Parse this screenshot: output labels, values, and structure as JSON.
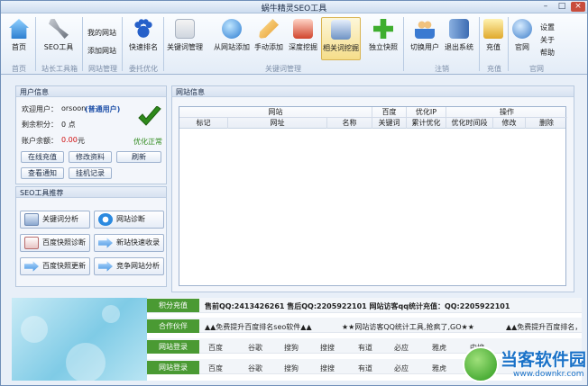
{
  "window": {
    "title": "蜗牛精灵SEO工具",
    "controls": [
      "–",
      "□",
      "×"
    ]
  },
  "ribbon": {
    "home": "首页",
    "seo_tool": "SEO工具",
    "my_sites": "我的网站",
    "add_site": "添加网站",
    "baidu_rank": "快速排名",
    "keyword_mgmt": "关键词管理",
    "from_site_add": "从网站添加",
    "manual_add": "手动添加",
    "deep_mine": "深度挖掘",
    "related_mine": "相关词挖掘",
    "independent_snapshot": "独立快照",
    "switch_user": "切换用户",
    "logout": "退出系统",
    "recharge": "充值",
    "official_site": "官网",
    "settings": "设置",
    "about": "关于",
    "help": "帮助",
    "groups": {
      "home": "首页",
      "toolbox": "站长工具箱",
      "site_mgmt": "网站管理",
      "ad_opt": "委托优化",
      "kw_mgmt": "关键词管理",
      "logout": "注销",
      "recharge": "充值",
      "official": "官网"
    }
  },
  "user": {
    "panel_title": "用户信息",
    "welcome_label": "欢迎用户：",
    "username": "orsoon",
    "user_type": "(普通用户)",
    "points_label": "剩余积分：",
    "points_value": "0 点",
    "balance_label": "账户余额：",
    "balance_value": "0.00",
    "balance_unit": "元",
    "status": "优化正常",
    "buttons": {
      "recharge": "在线充值",
      "edit": "修改资料",
      "refresh": "刷新",
      "notice": "查看通知",
      "log": "挂机记录"
    }
  },
  "seo_tools": {
    "title": "SEO工具推荐",
    "items": [
      {
        "label": "关键词分析",
        "icon": "keyword-analysis-icon"
      },
      {
        "label": "网站诊断",
        "icon": "ie-icon"
      },
      {
        "label": "百度快照诊断",
        "icon": "snapshot-diagnose-icon"
      },
      {
        "label": "新站快速收录",
        "icon": "arrows-icon"
      },
      {
        "label": "百度快照更新",
        "icon": "arrows-icon"
      },
      {
        "label": "竞争网站分析",
        "icon": "arrows-icon"
      }
    ]
  },
  "site_info": {
    "title": "网站信息",
    "group_headers": [
      "网站",
      "百度",
      "优化IP",
      "操作"
    ],
    "columns": [
      "标记",
      "网址",
      "名称",
      "关键词",
      "累计优化",
      "优化时间段",
      "修改",
      "删除"
    ],
    "rows": []
  },
  "bottom": {
    "tags": [
      "积分充值",
      "合作伙伴",
      "网站登录",
      "网站登录"
    ],
    "contact_line": "售前QQ:2413426261  售后QQ:2205922101  网站访客qq统计充值：QQ:2205922101",
    "marquee_1": "▲▲免费提升百度排名seo软件▲▲",
    "marquee_2": "★★网站访客QQ统计工具,抢疯了,GO★★",
    "marquee_3": "▲▲免费提升百度排名，",
    "links_row1": [
      "百度",
      "谷歌",
      "搜狗",
      "搜搜",
      "有道",
      "必应",
      "雅虎",
      "中搜"
    ],
    "links_row2": [
      "百度",
      "谷歌",
      "搜狗",
      "搜搜",
      "有道",
      "必应",
      "雅虎"
    ]
  },
  "watermark": {
    "name": "当客软件园",
    "url": "www.downkr.com"
  },
  "colors": {
    "accent_green": "#4a9a33",
    "title_blue": "#1d4fa8",
    "red": "#d01010"
  }
}
